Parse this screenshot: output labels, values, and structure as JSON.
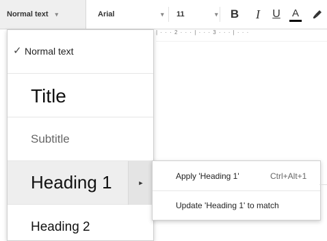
{
  "toolbar": {
    "style_value": "Normal text",
    "font_value": "Arial",
    "size_value": "11",
    "bold_label": "B",
    "italic_label": "I",
    "underline_label": "U",
    "text_color_label": "A"
  },
  "ruler": {
    "text": "| · · · 2 · · · | · · · 3 · · · | · · ·"
  },
  "style_menu": {
    "items": [
      {
        "label": "Normal text",
        "checked": true
      },
      {
        "label": "Title"
      },
      {
        "label": "Subtitle"
      },
      {
        "label": "Heading 1",
        "highlighted": true
      },
      {
        "label": "Heading 2"
      }
    ],
    "check_glyph": "✓",
    "submenu_arrow": "►"
  },
  "submenu": {
    "apply_label": "Apply 'Heading 1'",
    "apply_shortcut": "Ctrl+Alt+1",
    "update_label": "Update 'Heading 1' to match"
  },
  "icons": {
    "caret": "▾",
    "brush": "paint-format-icon"
  },
  "colors": {
    "highlight_bg": "#eeeeee",
    "text_color_bar": "#000000"
  }
}
